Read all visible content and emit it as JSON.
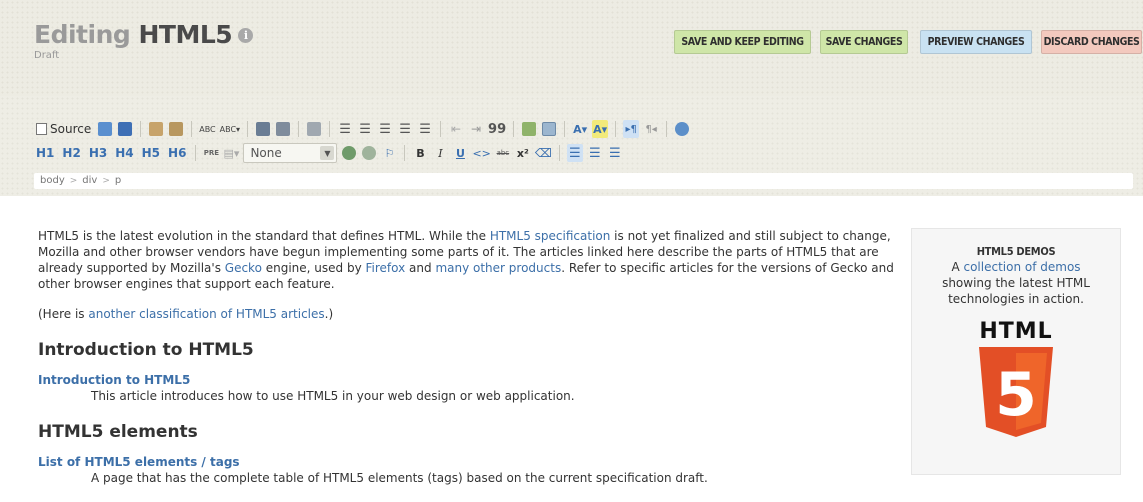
{
  "header": {
    "title_prefix": "Editing",
    "title_name": "HTML5",
    "info_icon": "i",
    "status": "Draft",
    "buttons": {
      "save_keep": "SAVE AND KEEP EDITING",
      "save": "SAVE CHANGES",
      "preview": "PREVIEW CHANGES",
      "discard": "DISCARD CHANGES"
    },
    "colors": {
      "green": "#cfe6a8",
      "blue": "#c9e2f2",
      "red": "#f3c9be"
    }
  },
  "toolbar": {
    "source_label": "Source",
    "headings": [
      "H1",
      "H2",
      "H3",
      "H4",
      "H5",
      "H6"
    ],
    "pre_label": "PRE",
    "format_value": "None",
    "bold": "B",
    "italic": "I",
    "underline": "U",
    "code": "<>",
    "strike": "abc",
    "superscript": "x²",
    "quote": "99",
    "path": [
      "body",
      "div",
      "p"
    ]
  },
  "content": {
    "intro": {
      "t1": "HTML5 is the latest evolution in the standard that defines HTML. While the ",
      "link1": "HTML5 specification",
      "t2": " is not yet finalized and still subject to change, Mozilla and other browser vendors have begun implementing some parts of it. The articles linked here describe the parts of HTML5 that are already supported by Mozilla's ",
      "link2": "Gecko",
      "t3": " engine, used by ",
      "link3": "Firefox",
      "t4": " and ",
      "link4": "many other products",
      "t5": ". Refer to specific articles for the versions of Gecko and other browser engines that support each feature."
    },
    "note": {
      "t1": "(Here is ",
      "link": "another classification of HTML5 articles",
      "t2": ".)"
    },
    "section1": {
      "heading": "Introduction to HTML5",
      "link": "Introduction to HTML5",
      "desc": "This article introduces how to use HTML5 in your web design or web application."
    },
    "section2": {
      "heading": "HTML5 elements",
      "link": "List of HTML5 elements / tags",
      "desc": "A page that has the complete table of HTML5 elements (tags) based on the current specification draft."
    }
  },
  "demos": {
    "title": "HTML5 DEMOS",
    "t1": "A ",
    "link": "collection of demos",
    "t2": "showing the latest HTML technologies in action.",
    "logo_word": "HTML",
    "logo_number": "5",
    "logo_colors": {
      "dark": "#e34f26",
      "light": "#ef652a"
    }
  }
}
